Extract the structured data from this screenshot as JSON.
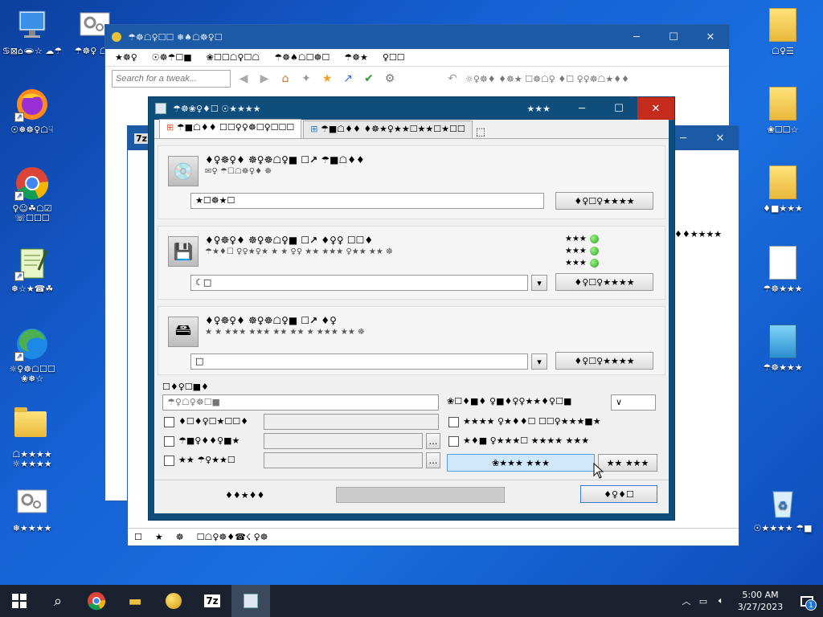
{
  "desktop": {
    "left_icons": [
      {
        "label": "♋⊠⌂🕳︎☆ ☁☂",
        "icon": "computer-icon"
      },
      {
        "label": "☉❅☸♀☖☟",
        "icon": "firefox-icon"
      },
      {
        "label": "♀☺☘☖☑ ☏☐☐☐",
        "icon": "chrome-icon"
      },
      {
        "label": "❅☆★☎☘",
        "icon": "notepad-icon"
      },
      {
        "label": "☼♀☸☖☐☐ ❀❅☆",
        "icon": "edge-icon"
      },
      {
        "label": "☖★★★★ ☼★★★★",
        "icon": "folder-icon"
      },
      {
        "label": "❅★★★★",
        "icon": "settings-file-icon"
      }
    ],
    "second_col_icon": {
      "label": "☂☸♀ ☖☗",
      "icon": "settings-file-icon"
    },
    "right_icons": [
      {
        "label": "☖♀☰",
        "icon": "folder-icon"
      },
      {
        "label": "❀☐☐☆",
        "icon": "folder-icon"
      },
      {
        "label": "♦■★★★",
        "icon": "document-folder-icon"
      },
      {
        "label": "☂☸★★★",
        "icon": "text-file-icon"
      },
      {
        "label": "☂☸★★★",
        "icon": "app-icon"
      },
      {
        "label": "☉★★★★ ☂■",
        "icon": "recycle-bin-icon"
      }
    ]
  },
  "back_window": {
    "title": "☂☸☖♀☐☐ ❅♠☖☸♀☐",
    "menu": [
      "★☸♀",
      "☉☸☂☐■",
      "❀☐☐☖♀☐☖",
      "☂☸♠☖☐☸☐",
      "☂☸★",
      "♀☐☐"
    ],
    "search_placeholder": "Search for a tweak...",
    "toolbar_text": "☼♀☸♦  ♦☸★  ☐☸☖♀  ♦☐  ♀♀☸☖★♦♦"
  },
  "mid_window": {
    "title": "7z",
    "row_text": "♦♦★★★★",
    "status": [
      "☐",
      "★",
      "☸",
      "☐☖♀☸♦☎☇ ♀☸"
    ]
  },
  "dialog": {
    "title": "☂☸❀♀♦☐ ☉★★★★",
    "title_right": "★★★",
    "tabs": [
      "☂■☖♦♦ ☐☐♀♀☸☐♀☐☐☐",
      "☂■☖♦♦ ♦☸★♀★★☐★★☐★☐☐"
    ],
    "panels": [
      {
        "heading": "♦♀☸♀♦ ☸♀☸☖♀■ ☐↗ ☂■☖♦♦",
        "sub": "✉♀ ☂☐☖☸♀♦ ☸",
        "value": "★☐☸★☐",
        "button": "♦♀☐♀★★★★"
      },
      {
        "heading": "♦♀☸♀♦ ☸♀☸☖♀■ ☐↗ ♦♀♀ ☐☐♦",
        "sub": "☂★♦☐ ♀♀★♀★ ★ ★ ♀♀ ★★ ★★★ ♀★★ ★★ ☸",
        "value": "☾□",
        "button": "♦♀☐♀★★★★",
        "status": [
          {
            "label": "★★★",
            "ok": true
          },
          {
            "label": "★★★",
            "ok": true
          },
          {
            "label": "★★★",
            "ok": true
          }
        ]
      },
      {
        "heading": "♦♀☸♀♦ ☸♀☸☖♀■ ☐↗ ♦♀",
        "sub": "★ ★ ★★★ ★★★ ★★ ★★ ★ ★★★ ★★ ☸",
        "value": "□",
        "button": "♦♀☐♀★★★★"
      }
    ],
    "options_heading": "☐♦♀☐■♦",
    "combo_value": "☂♀☖♀☸☐■",
    "right_label": "❀☐♦■♦  ♀■♦♀♀★★♦♀☐■",
    "right_combo": "∨",
    "checks_left": [
      "♦☐♦♀☐★☐☐♦",
      "☂■♀♦♦♀■★",
      "★★ ☂♀★★☐"
    ],
    "checks_right": [
      "★★★★ ♀★♦♦☐ ☐☐♀★★★■★",
      "★♦■ ♀★★★☐ ★★★★ ★★★"
    ],
    "btn_highlight": "❀★★★ ★★★",
    "btn_small": "★★ ★★★",
    "footer_left": "♦♦★♦♦",
    "footer_button": "♦♀♦☐"
  },
  "taskbar": {
    "time": "5:00 AM",
    "date": "3/27/2023",
    "notif_count": "1"
  }
}
